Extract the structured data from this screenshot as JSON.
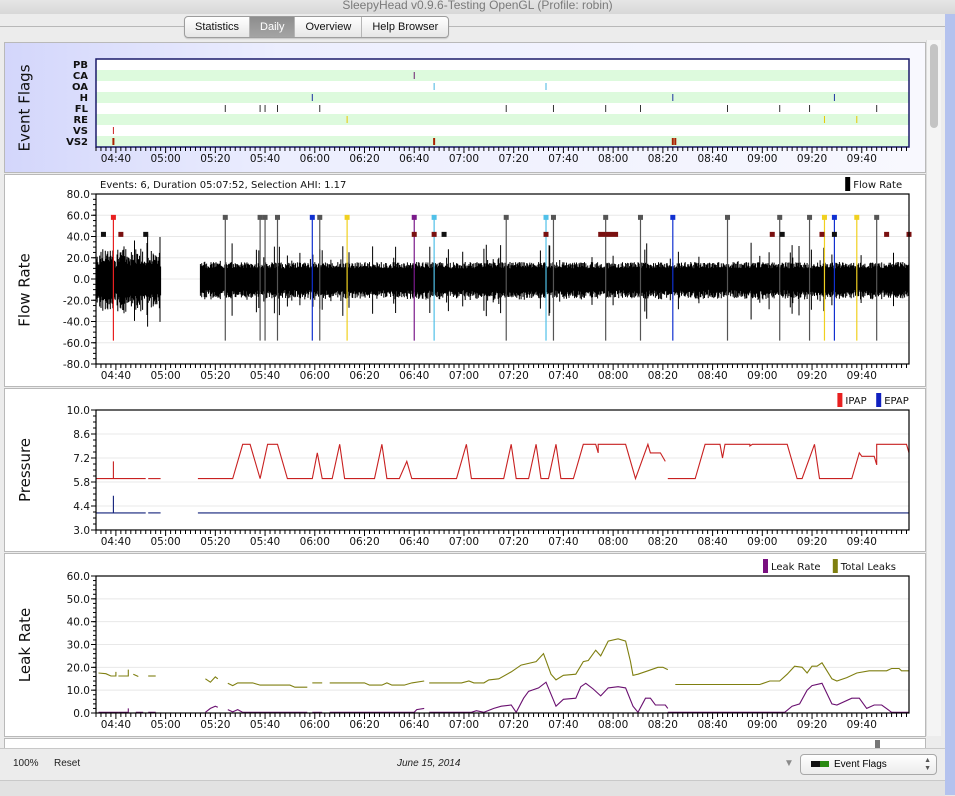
{
  "window": {
    "title": "SleepyHead v0.9.6-Testing OpenGL (Profile: robin)"
  },
  "tabs": [
    {
      "label": "Statistics",
      "active": false
    },
    {
      "label": "Daily",
      "active": true
    },
    {
      "label": "Overview",
      "active": false
    },
    {
      "label": "Help Browser",
      "active": false
    }
  ],
  "time_axis": {
    "range": [
      "04:32",
      "09:59"
    ],
    "tick_labels": [
      "04:40",
      "05:00",
      "05:20",
      "05:40",
      "06:00",
      "06:20",
      "06:40",
      "07:00",
      "07:20",
      "07:40",
      "08:00",
      "08:20",
      "08:40",
      "09:00",
      "09:20",
      "09:40"
    ]
  },
  "event_flags": {
    "title": "Event Flags",
    "rows": [
      "PB",
      "CA",
      "OA",
      "H",
      "FL",
      "RE",
      "VS",
      "VS2"
    ],
    "colors": {
      "PB": "#000000",
      "CA": "#6a1c6e",
      "OA": "#44b4e0",
      "H": "#1c2fa0",
      "FL": "#333333",
      "RE": "#e8c800",
      "VS": "#cc2222",
      "VS2": "#aa2200"
    },
    "events": {
      "PB": [],
      "CA": [
        "06:40"
      ],
      "OA": [
        "06:48",
        "07:33"
      ],
      "H": [
        "05:59",
        "08:24",
        "09:29"
      ],
      "FL": [
        "05:24",
        "05:38",
        "05:40",
        "05:45",
        "06:02",
        "07:17",
        "07:36",
        "07:57",
        "08:11",
        "08:46",
        "09:07",
        "09:19",
        "09:46"
      ],
      "RE": [
        "06:13",
        "09:25",
        "09:38"
      ],
      "VS": [
        "04:39"
      ],
      "VS2": [
        "04:39",
        "06:48",
        "08:24",
        "08:25"
      ]
    }
  },
  "flow_rate": {
    "title": "Flow Rate",
    "info": "Events: 6, Duration 05:07:52, Selection AHI: 1.17",
    "legend": [
      {
        "label": "Flow Rate",
        "color": "#000000"
      }
    ],
    "y_ticks": [
      "80.0",
      "60.0",
      "40.0",
      "20.0",
      "0.0",
      "-20.0",
      "-40.0",
      "-60.0",
      "-80.0"
    ],
    "ylim": [
      -80,
      80
    ],
    "data_segments": [
      [
        "04:32",
        "04:58"
      ],
      [
        "05:14",
        "06:58"
      ],
      [
        "06:58",
        "09:59"
      ]
    ],
    "event_lines": [
      {
        "t": "04:39",
        "color": "#e82020"
      },
      {
        "t": "05:24",
        "color": "#555555"
      },
      {
        "t": "05:38",
        "color": "#555555"
      },
      {
        "t": "05:40",
        "color": "#555555"
      },
      {
        "t": "05:45",
        "color": "#555555"
      },
      {
        "t": "05:59",
        "color": "#1030d0"
      },
      {
        "t": "06:02",
        "color": "#555555"
      },
      {
        "t": "06:13",
        "color": "#f0d020"
      },
      {
        "t": "06:40",
        "color": "#7a1a8a"
      },
      {
        "t": "06:48",
        "color": "#50c0e8"
      },
      {
        "t": "07:17",
        "color": "#555555"
      },
      {
        "t": "07:33",
        "color": "#50c0e8"
      },
      {
        "t": "07:36",
        "color": "#555555"
      },
      {
        "t": "07:57",
        "color": "#555555"
      },
      {
        "t": "08:11",
        "color": "#555555"
      },
      {
        "t": "08:24",
        "color": "#1030d0"
      },
      {
        "t": "08:46",
        "color": "#555555"
      },
      {
        "t": "09:07",
        "color": "#555555"
      },
      {
        "t": "09:19",
        "color": "#555555"
      },
      {
        "t": "09:25",
        "color": "#f0d020"
      },
      {
        "t": "09:29",
        "color": "#1030d0"
      },
      {
        "t": "09:38",
        "color": "#f0d020"
      },
      {
        "t": "09:46",
        "color": "#555555"
      }
    ],
    "markers_40": [
      {
        "t": "04:35",
        "color": "#111111"
      },
      {
        "t": "04:42",
        "color": "#7a1010"
      },
      {
        "t": "04:52",
        "color": "#111111"
      },
      {
        "t": "06:40",
        "color": "#7a1010"
      },
      {
        "t": "06:48",
        "color": "#7a1010"
      },
      {
        "t": "06:52",
        "color": "#111111"
      },
      {
        "t": "07:33",
        "color": "#7a1010"
      },
      {
        "t": "07:55",
        "color": "#7a1010",
        "dur": 3
      },
      {
        "t": "07:58",
        "color": "#7a1010",
        "dur": 5
      },
      {
        "t": "09:04",
        "color": "#7a1010"
      },
      {
        "t": "09:08",
        "color": "#111111"
      },
      {
        "t": "09:24",
        "color": "#7a1010"
      },
      {
        "t": "09:29",
        "color": "#111111"
      },
      {
        "t": "09:50",
        "color": "#7a1010"
      },
      {
        "t": "09:59",
        "color": "#7a1010"
      }
    ]
  },
  "pressure": {
    "title": "Pressure",
    "legend": [
      {
        "label": "IPAP",
        "color": "#e82020"
      },
      {
        "label": "EPAP",
        "color": "#1020c0"
      }
    ],
    "y_ticks": [
      "10.0",
      "8.6",
      "7.2",
      "5.8",
      "4.4",
      "3.0"
    ],
    "ylim": [
      3.0,
      10.0
    ],
    "ipap": [
      [
        [
          "04:32",
          6.0
        ],
        [
          "04:39",
          6.0
        ],
        [
          "04:39",
          7.0
        ],
        [
          "04:39",
          6.0
        ],
        [
          "04:52",
          6.0
        ]
      ],
      [
        [
          "04:53",
          6.0
        ],
        [
          "04:58",
          6.0
        ]
      ],
      [
        [
          "05:13",
          6.0
        ],
        [
          "05:27",
          6.0
        ],
        [
          "05:31",
          8.0
        ],
        [
          "05:34",
          8.0
        ],
        [
          "05:38",
          6.0
        ],
        [
          "05:41",
          8.0
        ],
        [
          "05:45",
          8.0
        ],
        [
          "05:49",
          6.0
        ],
        [
          "05:59",
          6.0
        ],
        [
          "06:01",
          7.5
        ],
        [
          "06:03",
          6.0
        ],
        [
          "06:07",
          6.0
        ],
        [
          "06:10",
          8.0
        ],
        [
          "06:12",
          6.0
        ],
        [
          "06:24",
          6.0
        ],
        [
          "06:27",
          8.0
        ],
        [
          "06:29",
          6.0
        ],
        [
          "06:34",
          6.0
        ],
        [
          "06:37",
          7.0
        ],
        [
          "06:39",
          6.0
        ],
        [
          "06:57",
          6.0
        ],
        [
          "07:01",
          8.0
        ],
        [
          "07:03",
          6.0
        ],
        [
          "07:16",
          6.0
        ],
        [
          "07:19",
          8.0
        ],
        [
          "07:21",
          6.0
        ],
        [
          "07:26",
          6.0
        ],
        [
          "07:29",
          8.0
        ],
        [
          "07:31",
          6.0
        ],
        [
          "07:34",
          6.0
        ],
        [
          "07:37",
          8.0
        ],
        [
          "07:39",
          6.0
        ],
        [
          "07:44",
          6.0
        ],
        [
          "07:48",
          8.0
        ],
        [
          "07:53",
          8.0
        ],
        [
          "07:54",
          7.5
        ],
        [
          "07:54",
          8.0
        ],
        [
          "08:05",
          8.0
        ],
        [
          "08:09",
          6.0
        ],
        [
          "08:14",
          8.0
        ],
        [
          "08:15",
          7.5
        ],
        [
          "08:19",
          7.5
        ],
        [
          "08:21",
          7.0
        ]
      ],
      [
        [
          "08:22",
          6.0
        ],
        [
          "08:33",
          6.0
        ],
        [
          "08:37",
          8.0
        ],
        [
          "08:43",
          8.0
        ],
        [
          "08:44",
          7.2
        ],
        [
          "08:45",
          8.0
        ],
        [
          "08:55",
          8.0
        ],
        [
          "08:55",
          7.9
        ],
        [
          "08:56",
          8.0
        ],
        [
          "09:10",
          8.0
        ],
        [
          "09:14",
          6.0
        ],
        [
          "09:16",
          6.0
        ],
        [
          "09:21",
          8.0
        ],
        [
          "09:23",
          6.0
        ],
        [
          "09:36",
          6.0
        ],
        [
          "09:39",
          7.5
        ],
        [
          "09:40",
          7.3
        ],
        [
          "09:45",
          7.3
        ],
        [
          "09:46",
          6.8
        ],
        [
          "09:46",
          8.0
        ],
        [
          "09:58",
          8.0
        ],
        [
          "09:59",
          7.5
        ]
      ]
    ],
    "epap": [
      [
        [
          "04:32",
          4.0
        ],
        [
          "04:39",
          4.0
        ],
        [
          "04:39",
          5.0
        ],
        [
          "04:39",
          4.0
        ],
        [
          "04:52",
          4.0
        ]
      ],
      [
        [
          "04:53",
          4.0
        ],
        [
          "04:58",
          4.0
        ]
      ],
      [
        [
          "05:13",
          4.0
        ],
        [
          "09:59",
          4.0
        ]
      ]
    ]
  },
  "leak_rate": {
    "title": "Leak Rate",
    "legend": [
      {
        "label": "Leak Rate",
        "color": "#7a1080"
      },
      {
        "label": "Total Leaks",
        "color": "#7f7f10"
      }
    ],
    "y_ticks": [
      "60.0",
      "50.0",
      "40.0",
      "30.0",
      "20.0",
      "10.0",
      "0.0"
    ],
    "ylim": [
      0,
      60
    ],
    "total_leaks": [
      [
        [
          "04:33",
          17.5
        ],
        [
          "04:36",
          17.2
        ],
        [
          "04:38",
          16.2
        ],
        [
          "04:40",
          16.2
        ],
        [
          "04:40",
          18.0
        ]
      ],
      [
        [
          "04:41",
          16.2
        ],
        [
          "04:45",
          16.2
        ],
        [
          "04:45",
          19.0
        ]
      ],
      [
        [
          "04:47",
          17.0
        ],
        [
          "04:49",
          16.0
        ]
      ],
      [
        [
          "04:53",
          16.2
        ],
        [
          "04:56",
          16.2
        ]
      ],
      [
        [
          "05:16",
          15.0
        ],
        [
          "05:18",
          13.5
        ],
        [
          "05:20",
          15.8
        ],
        [
          "05:21",
          15.0
        ]
      ],
      [
        [
          "05:25",
          13.0
        ],
        [
          "05:27",
          12.0
        ],
        [
          "05:29",
          13.2
        ],
        [
          "05:35",
          13.2
        ],
        [
          "05:38",
          12.2
        ],
        [
          "05:50",
          12.2
        ],
        [
          "05:52",
          11.3
        ],
        [
          "05:57",
          11.3
        ]
      ],
      [
        [
          "05:59",
          13.2
        ],
        [
          "06:03",
          13.2
        ]
      ],
      [
        [
          "06:06",
          13.2
        ],
        [
          "06:20",
          13.2
        ],
        [
          "06:22",
          12.2
        ],
        [
          "06:27",
          12.2
        ],
        [
          "06:29",
          13.2
        ],
        [
          "06:31",
          12.2
        ],
        [
          "06:36",
          12.2
        ],
        [
          "06:39",
          13.2
        ],
        [
          "06:44",
          14.0
        ]
      ],
      [
        [
          "06:46",
          13.2
        ],
        [
          "06:59",
          13.2
        ],
        [
          "07:02",
          14.0
        ],
        [
          "07:04",
          13.2
        ],
        [
          "07:08",
          13.2
        ],
        [
          "07:10",
          14.5
        ],
        [
          "07:14",
          15.0
        ],
        [
          "07:19",
          18.0
        ],
        [
          "07:23",
          21.0
        ],
        [
          "07:29",
          22.5
        ],
        [
          "07:32",
          26.0
        ],
        [
          "07:35",
          17.0
        ],
        [
          "07:37",
          14.5
        ],
        [
          "07:40",
          16.5
        ],
        [
          "07:45",
          17.0
        ],
        [
          "07:48",
          22.5
        ],
        [
          "07:50",
          23.0
        ],
        [
          "07:53",
          27.5
        ],
        [
          "07:55",
          25.0
        ],
        [
          "07:58",
          31.5
        ],
        [
          "08:02",
          32.5
        ],
        [
          "08:05",
          31.5
        ],
        [
          "08:07",
          22.5
        ],
        [
          "08:08",
          16.5
        ],
        [
          "08:10",
          17.0
        ],
        [
          "08:14",
          18.5
        ],
        [
          "08:18",
          20.0
        ],
        [
          "08:20",
          20.0
        ],
        [
          "08:22",
          19.0
        ]
      ],
      [
        [
          "08:25",
          12.5
        ],
        [
          "08:59",
          12.5
        ],
        [
          "09:03",
          14.0
        ],
        [
          "09:07",
          14.0
        ],
        [
          "09:10",
          17.0
        ],
        [
          "09:13",
          20.5
        ],
        [
          "09:16",
          20.0
        ],
        [
          "09:18",
          17.5
        ],
        [
          "09:20",
          20.5
        ],
        [
          "09:22",
          20.5
        ],
        [
          "09:24",
          22.0
        ],
        [
          "09:28",
          15.0
        ],
        [
          "09:30",
          14.0
        ],
        [
          "09:34",
          15.5
        ],
        [
          "09:38",
          17.5
        ],
        [
          "09:43",
          18.5
        ],
        [
          "09:50",
          18.5
        ],
        [
          "09:52",
          19.5
        ],
        [
          "09:55",
          19.5
        ],
        [
          "09:56",
          18.5
        ],
        [
          "09:59",
          18.5
        ]
      ]
    ],
    "leak_rate": [
      [
        [
          "04:33",
          0.3
        ],
        [
          "04:41",
          0.3
        ]
      ],
      [
        [
          "04:41",
          0.3
        ],
        [
          "04:45",
          0.3
        ],
        [
          "04:45",
          2.0
        ]
      ],
      [
        [
          "04:48",
          0.3
        ],
        [
          "04:51",
          0.3
        ]
      ],
      [
        [
          "04:53",
          0.3
        ],
        [
          "04:56",
          0.3
        ]
      ],
      [
        [
          "05:16",
          0.3
        ],
        [
          "05:18",
          2.0
        ],
        [
          "05:20",
          3.0
        ],
        [
          "05:21",
          2.5
        ]
      ],
      [
        [
          "05:25",
          1.5
        ],
        [
          "05:27",
          0.5
        ],
        [
          "05:29",
          1.5
        ],
        [
          "05:31",
          0.3
        ],
        [
          "05:57",
          0.3
        ]
      ],
      [
        [
          "05:59",
          0.3
        ],
        [
          "06:03",
          0.3
        ]
      ],
      [
        [
          "06:06",
          0.3
        ],
        [
          "06:40",
          0.3
        ],
        [
          "06:41",
          1.5
        ],
        [
          "06:44",
          2.0
        ]
      ],
      [
        [
          "06:46",
          0.3
        ],
        [
          "07:03",
          0.3
        ],
        [
          "07:05",
          1.0
        ],
        [
          "07:08",
          0.3
        ],
        [
          "07:12",
          2.0
        ],
        [
          "07:15",
          3.0
        ],
        [
          "07:19",
          3.5
        ],
        [
          "07:21",
          0.3
        ],
        [
          "07:24",
          6.5
        ],
        [
          "07:26",
          9.5
        ],
        [
          "07:30",
          11.0
        ],
        [
          "07:33",
          13.5
        ],
        [
          "07:37",
          3.0
        ],
        [
          "07:40",
          6.0
        ],
        [
          "07:45",
          6.5
        ],
        [
          "07:47",
          11.5
        ],
        [
          "07:49",
          13.0
        ],
        [
          "07:52",
          10.5
        ],
        [
          "07:55",
          7.5
        ],
        [
          "07:58",
          11.0
        ],
        [
          "08:02",
          11.5
        ],
        [
          "08:05",
          11.0
        ],
        [
          "08:08",
          3.0
        ],
        [
          "08:10",
          0.3
        ],
        [
          "08:13",
          6.5
        ],
        [
          "08:15",
          6.5
        ],
        [
          "08:17",
          3.5
        ],
        [
          "08:21",
          3.5
        ],
        [
          "08:22",
          2.0
        ]
      ],
      [
        [
          "08:22",
          0.3
        ],
        [
          "08:25",
          0.3
        ],
        [
          "09:09",
          0.3
        ],
        [
          "09:12",
          3.0
        ],
        [
          "09:15",
          4.0
        ],
        [
          "09:18",
          10.0
        ],
        [
          "09:20",
          12.0
        ],
        [
          "09:24",
          13.0
        ],
        [
          "09:28",
          4.0
        ],
        [
          "09:30",
          3.5
        ],
        [
          "09:36",
          6.5
        ],
        [
          "09:39",
          6.5
        ],
        [
          "09:42",
          2.0
        ],
        [
          "09:45",
          3.5
        ],
        [
          "09:48",
          3.5
        ],
        [
          "09:52",
          0.3
        ],
        [
          "09:59",
          0.3
        ]
      ]
    ]
  },
  "footer": {
    "zoom_level": "100%",
    "reset_label": "Reset",
    "date": "June 15, 2014",
    "graph_select_value": "Event Flags"
  }
}
